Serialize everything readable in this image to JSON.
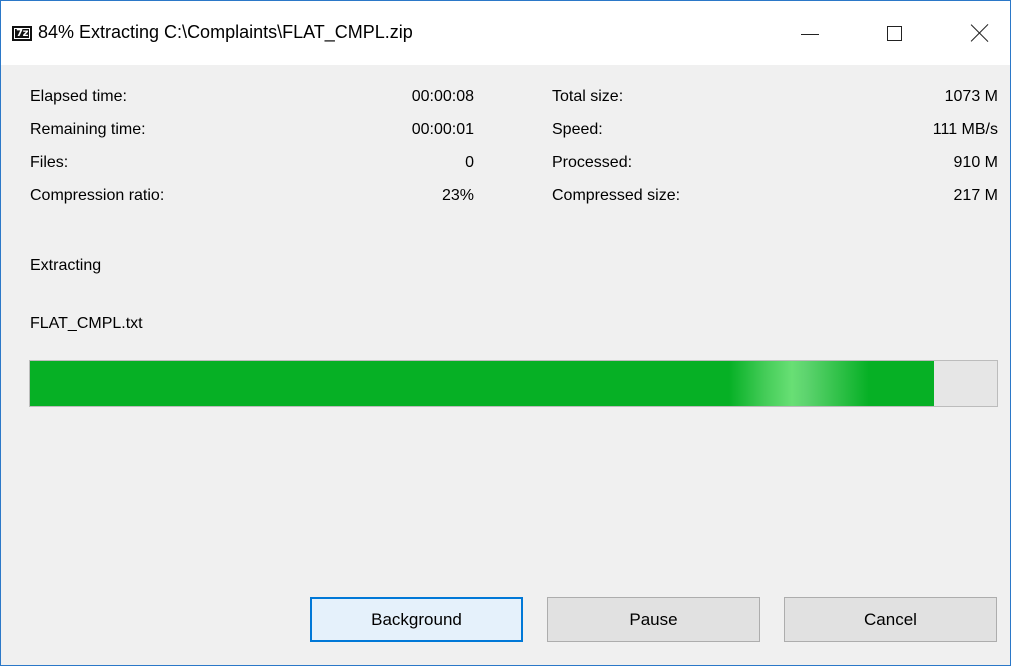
{
  "window": {
    "title": "84% Extracting C:\\Complaints\\FLAT_CMPL.zip",
    "icon": "7z-app-icon",
    "icon_text": "7z",
    "controls": [
      "minimize",
      "maximize",
      "close"
    ]
  },
  "stats": {
    "left": [
      {
        "label": "Elapsed time:",
        "value": "00:00:08"
      },
      {
        "label": "Remaining time:",
        "value": "00:00:01"
      },
      {
        "label": "Files:",
        "value": "0"
      },
      {
        "label": "Compression ratio:",
        "value": "23%"
      }
    ],
    "right": [
      {
        "label": "Total size:",
        "value": "1073 M"
      },
      {
        "label": "Speed:",
        "value": "111 MB/s"
      },
      {
        "label": "Processed:",
        "value": "910 M"
      },
      {
        "label": "Compressed size:",
        "value": "217 M"
      }
    ]
  },
  "status": {
    "operation": "Extracting",
    "current_file": "FLAT_CMPL.txt"
  },
  "progress": {
    "fraction": 0.935,
    "color": "#06b025"
  },
  "buttons": {
    "background": "Background",
    "pause": "Pause",
    "cancel": "Cancel"
  }
}
